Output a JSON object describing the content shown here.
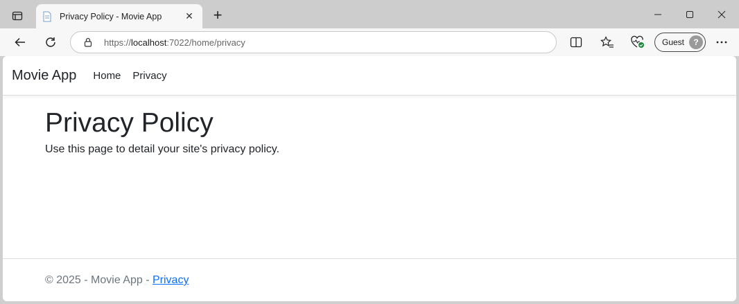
{
  "browser": {
    "tab": {
      "title": "Privacy Policy - Movie App"
    },
    "address": {
      "scheme": "https://",
      "host": "localhost",
      "rest": ":7022/home/privacy"
    },
    "profile": {
      "label": "Guest"
    }
  },
  "site": {
    "brand": "Movie App",
    "nav": [
      {
        "label": "Home"
      },
      {
        "label": "Privacy"
      }
    ]
  },
  "page": {
    "title": "Privacy Policy",
    "text": "Use this page to detail your site's privacy policy."
  },
  "footer": {
    "copyright": "© 2025 - Movie App - ",
    "link": "Privacy"
  },
  "colors": {
    "link": "#0d6efd",
    "text": "#212529",
    "muted": "#6c757d"
  }
}
